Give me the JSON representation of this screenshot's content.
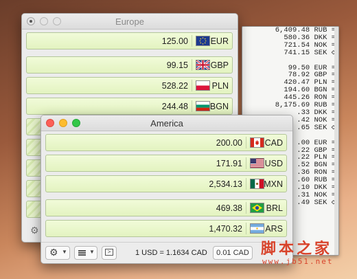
{
  "log": {
    "lines": [
      "6,409.48 RUB =",
      "580.36 DKK =",
      "721.54 NOK =",
      "741.15 SEK ◇",
      "",
      "99.50 EUR =",
      "78.92 GBP =",
      "420.47 PLN =",
      "194.60 BGN =",
      "445.26 RON =",
      "8,175.69 RUB =",
      ".33 DKK =",
      ".42 NOK =",
      ".65 SEK ◇",
      "",
      ".00 EUR =",
      ".22 GBP =",
      ".22 PLN =",
      ".52 BGN =",
      ".36 RON =",
      ".60 RUB =",
      ".10 DKK =",
      ".31 NOK =",
      ".49 SEK ◇"
    ]
  },
  "europe": {
    "title": "Europe",
    "rows": [
      {
        "value": "125.00",
        "code": "EUR",
        "flag": "eu-flag"
      },
      {
        "value": "99.15",
        "code": "GBP",
        "flag": "uk-flag"
      },
      {
        "value": "528.22",
        "code": "PLN",
        "flag": "poland-flag"
      },
      {
        "value": "244.48",
        "code": "BGN",
        "flag": "bulgaria-flag"
      }
    ]
  },
  "america": {
    "title": "America",
    "rows": [
      {
        "value": "200.00",
        "code": "CAD",
        "flag": "canada-flag"
      },
      {
        "value": "171.91",
        "code": "USD",
        "flag": "usa-flag"
      },
      {
        "value": "2,534.13",
        "code": "MXN",
        "flag": "mexico-flag"
      },
      {
        "value": "469.38",
        "code": "BRL",
        "flag": "brazil-flag"
      },
      {
        "value": "1,470.32",
        "code": "ARS",
        "flag": "argentina-flag"
      }
    ],
    "toolbar": {
      "gear_icon": "gear-icon",
      "list_icon": "list-icon",
      "terminal_icon": "terminal-icon",
      "rate_text": "1 USD = 1.1634 CAD",
      "step_value": "0.01 CAD"
    }
  },
  "watermark": {
    "main": "脚本之家",
    "sub": "www.jb51.net",
    "color": "#d8432b"
  }
}
